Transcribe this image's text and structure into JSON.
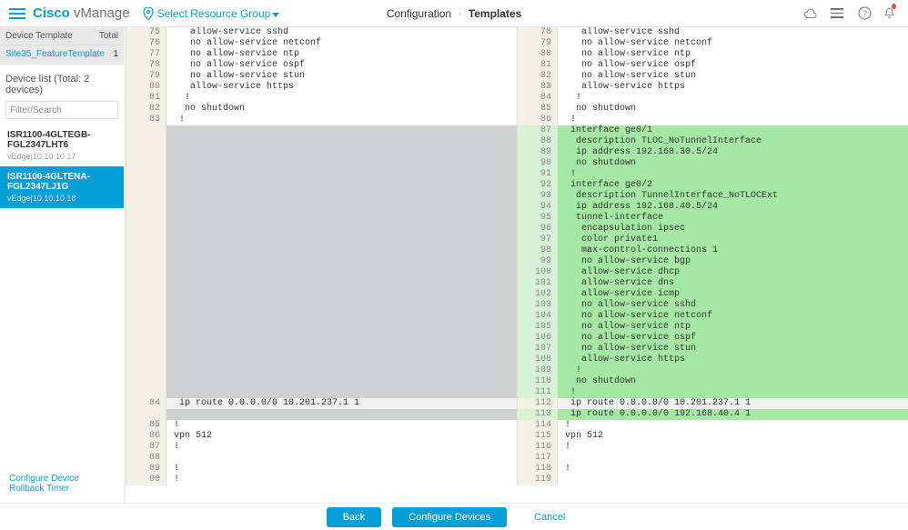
{
  "header": {
    "brand_main": "Cisco",
    "brand_sub": "vManage",
    "resource_group": "Select Resource Group",
    "crumb_parent": "Configuration",
    "crumb_current": "Templates"
  },
  "sidebar": {
    "template_label": "Device Template",
    "total_label": "Total",
    "template_name": "Site35_FeatureTemplate",
    "total_count": "1",
    "device_list_title": "Device list (Total: 2 devices)",
    "filter_placeholder": "Filter/Search",
    "devices": [
      {
        "name": "ISR1100-4GLTEGB-FGL2347LHT6",
        "sub": "vEdge|10.10.10.17",
        "active": false
      },
      {
        "name": "ISR1100-4GLTENA-FGL2347LJ1G",
        "sub": "vEdge|10.10.10.18",
        "active": true
      }
    ],
    "rollback_link": "Configure Device Rollback Timer"
  },
  "diff": {
    "left": [
      {
        "n": 75,
        "t": "   allow-service sshd",
        "k": "normal"
      },
      {
        "n": 76,
        "t": "   no allow-service netconf",
        "k": "normal"
      },
      {
        "n": 77,
        "t": "   no allow-service ntp",
        "k": "normal"
      },
      {
        "n": 78,
        "t": "   no allow-service ospf",
        "k": "normal"
      },
      {
        "n": 79,
        "t": "   no allow-service stun",
        "k": "normal"
      },
      {
        "n": 80,
        "t": "   allow-service https",
        "k": "normal"
      },
      {
        "n": 81,
        "t": "  !",
        "k": "normal"
      },
      {
        "n": 82,
        "t": "  no shutdown",
        "k": "normal"
      },
      {
        "n": 83,
        "t": " !",
        "k": "normal"
      },
      {
        "n": "",
        "t": " ",
        "k": "placeholder"
      },
      {
        "n": "",
        "t": " ",
        "k": "placeholder"
      },
      {
        "n": "",
        "t": " ",
        "k": "placeholder"
      },
      {
        "n": "",
        "t": " ",
        "k": "placeholder"
      },
      {
        "n": "",
        "t": " ",
        "k": "placeholder"
      },
      {
        "n": "",
        "t": " ",
        "k": "placeholder"
      },
      {
        "n": "",
        "t": " ",
        "k": "placeholder"
      },
      {
        "n": "",
        "t": " ",
        "k": "placeholder"
      },
      {
        "n": "",
        "t": " ",
        "k": "placeholder"
      },
      {
        "n": "",
        "t": " ",
        "k": "placeholder"
      },
      {
        "n": "",
        "t": " ",
        "k": "placeholder"
      },
      {
        "n": "",
        "t": " ",
        "k": "placeholder"
      },
      {
        "n": "",
        "t": " ",
        "k": "placeholder"
      },
      {
        "n": "",
        "t": " ",
        "k": "placeholder"
      },
      {
        "n": "",
        "t": " ",
        "k": "placeholder"
      },
      {
        "n": "",
        "t": " ",
        "k": "placeholder"
      },
      {
        "n": "",
        "t": " ",
        "k": "placeholder"
      },
      {
        "n": "",
        "t": " ",
        "k": "placeholder"
      },
      {
        "n": "",
        "t": " ",
        "k": "placeholder"
      },
      {
        "n": "",
        "t": " ",
        "k": "placeholder"
      },
      {
        "n": "",
        "t": " ",
        "k": "placeholder"
      },
      {
        "n": "",
        "t": " ",
        "k": "placeholder"
      },
      {
        "n": "",
        "t": " ",
        "k": "placeholder"
      },
      {
        "n": "",
        "t": " ",
        "k": "placeholder"
      },
      {
        "n": "",
        "t": " ",
        "k": "placeholder"
      },
      {
        "n": 84,
        "t": " ip route 0.0.0.0/0 10.201.237.1 1",
        "k": "highlight"
      },
      {
        "n": "",
        "t": " ",
        "k": "placeholder"
      },
      {
        "n": 85,
        "t": "!",
        "k": "normal"
      },
      {
        "n": 86,
        "t": "vpn 512",
        "k": "normal"
      },
      {
        "n": 87,
        "t": "!",
        "k": "normal"
      },
      {
        "n": 88,
        "t": "",
        "k": "normal"
      },
      {
        "n": 89,
        "t": "!",
        "k": "normal"
      },
      {
        "n": 90,
        "t": "!",
        "k": "normal"
      }
    ],
    "right": [
      {
        "n": 78,
        "t": "   allow-service sshd",
        "k": "normal"
      },
      {
        "n": 79,
        "t": "   no allow-service netconf",
        "k": "normal"
      },
      {
        "n": 80,
        "t": "   no allow-service ntp",
        "k": "normal"
      },
      {
        "n": 81,
        "t": "   no allow-service ospf",
        "k": "normal"
      },
      {
        "n": 82,
        "t": "   no allow-service stun",
        "k": "normal"
      },
      {
        "n": 83,
        "t": "   allow-service https",
        "k": "normal"
      },
      {
        "n": 84,
        "t": "  !",
        "k": "normal"
      },
      {
        "n": 85,
        "t": "  no shutdown",
        "k": "normal"
      },
      {
        "n": 86,
        "t": " !",
        "k": "normal"
      },
      {
        "n": 87,
        "t": " interface ge0/1",
        "k": "added"
      },
      {
        "n": 88,
        "t": "  description TLOC_NoTunnelInterface",
        "k": "added"
      },
      {
        "n": 89,
        "t": "  ip address 192.168.30.5/24",
        "k": "added"
      },
      {
        "n": 90,
        "t": "  no shutdown",
        "k": "added"
      },
      {
        "n": 91,
        "t": " !",
        "k": "added"
      },
      {
        "n": 92,
        "t": " interface ge0/2",
        "k": "added"
      },
      {
        "n": 93,
        "t": "  description TunnelInterface_NoTLOCExt",
        "k": "added"
      },
      {
        "n": 94,
        "t": "  ip address 192.168.40.5/24",
        "k": "added"
      },
      {
        "n": 95,
        "t": "  tunnel-interface",
        "k": "added"
      },
      {
        "n": 96,
        "t": "   encapsulation ipsec",
        "k": "added"
      },
      {
        "n": 97,
        "t": "   color private1",
        "k": "added"
      },
      {
        "n": 98,
        "t": "   max-control-connections 1",
        "k": "added"
      },
      {
        "n": 99,
        "t": "   no allow-service bgp",
        "k": "added"
      },
      {
        "n": 100,
        "t": "   allow-service dhcp",
        "k": "added"
      },
      {
        "n": 101,
        "t": "   allow-service dns",
        "k": "added"
      },
      {
        "n": 102,
        "t": "   allow-service icmp",
        "k": "added"
      },
      {
        "n": 103,
        "t": "   no allow-service sshd",
        "k": "added"
      },
      {
        "n": 104,
        "t": "   no allow-service netconf",
        "k": "added"
      },
      {
        "n": 105,
        "t": "   no allow-service ntp",
        "k": "added"
      },
      {
        "n": 106,
        "t": "   no allow-service ospf",
        "k": "added"
      },
      {
        "n": 107,
        "t": "   no allow-service stun",
        "k": "added"
      },
      {
        "n": 108,
        "t": "   allow-service https",
        "k": "added"
      },
      {
        "n": 109,
        "t": "  !",
        "k": "added"
      },
      {
        "n": 110,
        "t": "  no shutdown",
        "k": "added"
      },
      {
        "n": 111,
        "t": " !",
        "k": "added"
      },
      {
        "n": 112,
        "t": " ip route 0.0.0.0/0 10.201.237.1 1",
        "k": "highlight"
      },
      {
        "n": 113,
        "t": " ip route 0.0.0.0/0 192.168.40.4 1",
        "k": "added"
      },
      {
        "n": 114,
        "t": "!",
        "k": "normal"
      },
      {
        "n": 115,
        "t": "vpn 512",
        "k": "normal"
      },
      {
        "n": 116,
        "t": "!",
        "k": "normal"
      },
      {
        "n": 117,
        "t": "",
        "k": "normal"
      },
      {
        "n": 118,
        "t": "!",
        "k": "normal"
      },
      {
        "n": 119,
        "t": "",
        "k": "normal"
      }
    ]
  },
  "footer": {
    "back": "Back",
    "configure": "Configure Devices",
    "cancel": "Cancel"
  }
}
